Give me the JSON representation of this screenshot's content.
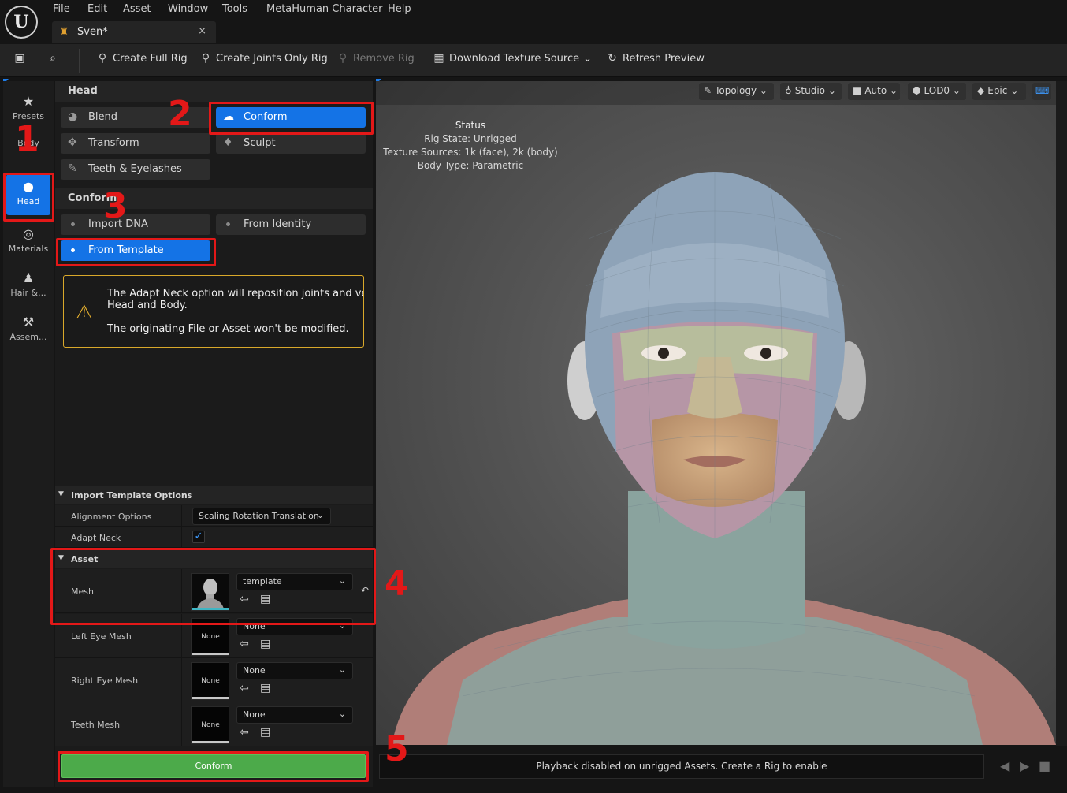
{
  "menu": [
    "File",
    "Edit",
    "Asset",
    "Window",
    "Tools",
    "MetaHuman Character",
    "Help"
  ],
  "doc_tab": {
    "label": "Sven*",
    "close": "×"
  },
  "toolbar": {
    "create_full_rig": "Create Full Rig",
    "create_joints_only_rig": "Create Joints Only Rig",
    "remove_rig": "Remove Rig",
    "download_texture_source": "Download Texture Source",
    "refresh_preview": "Refresh Preview"
  },
  "categories": [
    {
      "label": "Presets",
      "icon": "star-icon"
    },
    {
      "label": "Body",
      "icon": "body-icon"
    },
    {
      "label": "Head",
      "icon": "head-icon",
      "active": true
    },
    {
      "label": "Materials",
      "icon": "materials-icon"
    },
    {
      "label": "Hair &...",
      "icon": "hair-icon"
    },
    {
      "label": "Assem...",
      "icon": "hammer-icon"
    }
  ],
  "head_section": {
    "title": "Head",
    "tools": [
      "Blend",
      "Conform",
      "Transform",
      "Sculpt",
      "Teeth & Eyelashes"
    ],
    "active_tool": "Conform"
  },
  "conform_section": {
    "title": "Conform",
    "modes": [
      "Import DNA",
      "From Identity",
      "From Template"
    ],
    "active_mode": "From Template"
  },
  "warning": {
    "line1": "The Adapt Neck option will reposition joints and vertices",
    "line2": "Head and Body.",
    "line3": "The originating File or Asset won't be modified."
  },
  "import_options": {
    "title": "Import Template Options",
    "alignment_label": "Alignment Options",
    "alignment_value": "Scaling Rotation Translation",
    "adapt_neck_label": "Adapt Neck",
    "adapt_neck_checked": true
  },
  "asset": {
    "title": "Asset",
    "rows": [
      {
        "label": "Mesh",
        "value": "template",
        "thumb": ""
      },
      {
        "label": "Left Eye Mesh",
        "value": "None",
        "thumb": "None"
      },
      {
        "label": "Right Eye Mesh",
        "value": "None",
        "thumb": "None"
      },
      {
        "label": "Teeth Mesh",
        "value": "None",
        "thumb": "None"
      }
    ]
  },
  "conform_button": "Conform",
  "viewport": {
    "buttons": [
      "Topology",
      "Studio",
      "Auto",
      "LOD0",
      "Epic"
    ],
    "status_title": "Status",
    "rig_state": "Rig State: Unrigged",
    "texture_sources": "Texture Sources: 1k (face), 2k (body)",
    "body_type": "Body Type: Parametric"
  },
  "playback_message": "Playback disabled on unrigged Assets. Create a Rig to enable",
  "annotations": [
    "1",
    "2",
    "3",
    "4",
    "5"
  ],
  "colors": {
    "accent": "#1473e6",
    "annotation": "#e31818",
    "conform_button": "#4caa4a",
    "warning_border": "#d9a82a"
  }
}
